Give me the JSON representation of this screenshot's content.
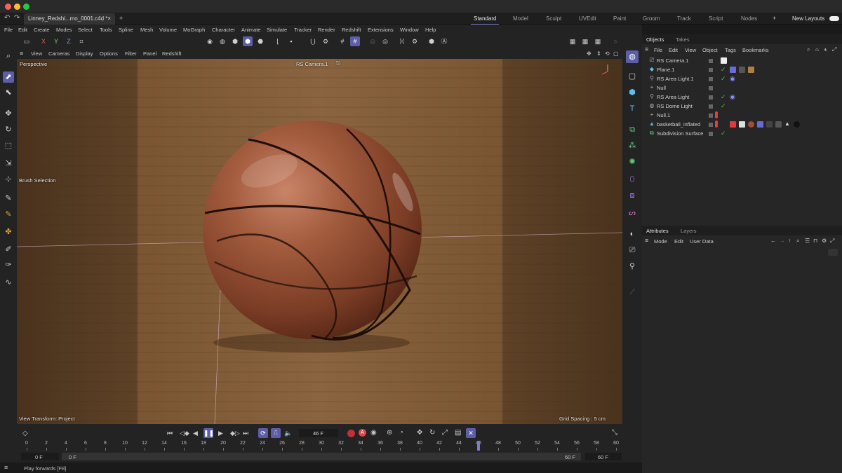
{
  "titlebar": {
    "colors": {
      "close": "#ff5f57",
      "min": "#febc2e",
      "max": "#28c840"
    }
  },
  "tabs": {
    "document": "Linney_Redshi...mo_0001.c4d *",
    "close_glyph": "×",
    "add_glyph": "+",
    "layouts": [
      "Standard",
      "Model",
      "Sculpt",
      "UVEdit",
      "Paint",
      "Groom",
      "Track",
      "Script",
      "Nodes"
    ],
    "active_layout": "Standard",
    "new_layouts": "New Layouts"
  },
  "menubar": [
    "File",
    "Edit",
    "Create",
    "Modes",
    "Select",
    "Tools",
    "Spline",
    "Mesh",
    "Volume",
    "MoGraph",
    "Character",
    "Animate",
    "Simulate",
    "Tracker",
    "Render",
    "Redshift",
    "Extensions",
    "Window",
    "Help"
  ],
  "axis_toggles": {
    "x": "X",
    "y": "Y",
    "z": "Z"
  },
  "viewport": {
    "menu": [
      "View",
      "Cameras",
      "Display",
      "Options",
      "Filter",
      "Panel",
      "Redshift"
    ],
    "camera_mode": "Perspective",
    "active_camera": "RS Camera.1",
    "brush_selection": "Brush Selection",
    "view_transform": "View Transform: Project",
    "grid_spacing": "Grid Spacing : 5 cm",
    "colors": {
      "floor": "#7a5532",
      "ball": "#a25b3d"
    }
  },
  "timeline": {
    "current_frame": "46 F",
    "ruler": [
      "0",
      "2",
      "4",
      "6",
      "8",
      "10",
      "12",
      "14",
      "16",
      "18",
      "20",
      "22",
      "24",
      "26",
      "28",
      "30",
      "32",
      "34",
      "36",
      "38",
      "40",
      "42",
      "44",
      "46",
      "48",
      "50",
      "52",
      "54",
      "56",
      "58",
      "60"
    ],
    "playhead": 46,
    "start_field": "0 F",
    "min_field": "0 F",
    "max_field": "60 F",
    "end_field": "60 F"
  },
  "status": {
    "text": "Play forwards [F8]"
  },
  "objects_panel": {
    "tabs": [
      "Objects",
      "Takes"
    ],
    "menu": [
      "File",
      "Edit",
      "View",
      "Object",
      "Tags",
      "Bookmarks"
    ],
    "items": [
      {
        "name": "RS Camera.1",
        "icon": "camera-icon"
      },
      {
        "name": "Plane.1",
        "icon": "plane-icon"
      },
      {
        "name": "RS Area Light.1",
        "icon": "light-icon"
      },
      {
        "name": "Null",
        "icon": "null-icon"
      },
      {
        "name": "RS Area Light",
        "icon": "light-icon"
      },
      {
        "name": "RS Dome Light",
        "icon": "dome-light-icon"
      },
      {
        "name": "Null.1",
        "icon": "null-icon"
      },
      {
        "name": "basketball_inflated",
        "icon": "mesh-icon"
      },
      {
        "name": "Subdivision Surface",
        "icon": "subdivision-icon"
      }
    ]
  },
  "attributes_panel": {
    "tabs": [
      "Attributes",
      "Layers"
    ],
    "menu": [
      "Mode",
      "Edit",
      "User Data"
    ]
  }
}
